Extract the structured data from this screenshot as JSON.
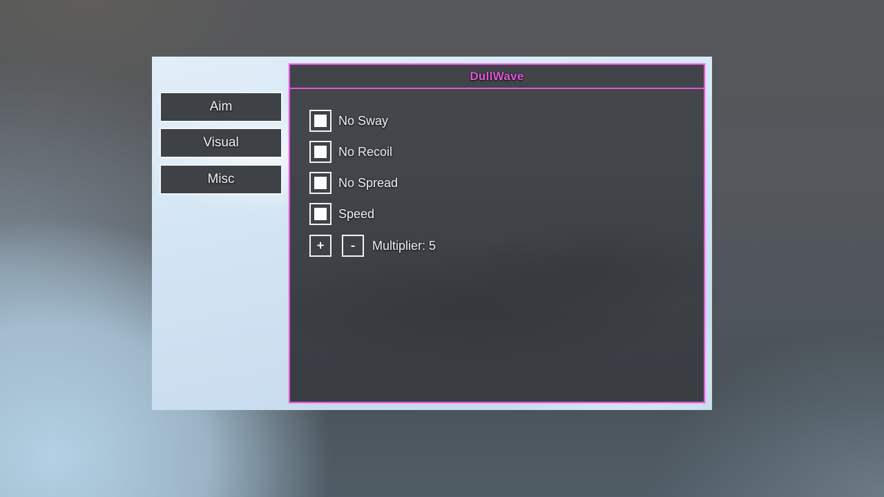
{
  "window": {
    "title": "DullWave",
    "sidebar": {
      "items": [
        {
          "label": "Aim"
        },
        {
          "label": "Visual"
        },
        {
          "label": "Misc"
        }
      ]
    },
    "panel": {
      "checkboxes": [
        {
          "label": "No Sway",
          "checked": false
        },
        {
          "label": "No Recoil",
          "checked": false
        },
        {
          "label": "No Spread",
          "checked": false
        },
        {
          "label": "Speed",
          "checked": false
        }
      ],
      "multiplier": {
        "increase_glyph": "+",
        "decrease_glyph": "-",
        "label_prefix": "Multiplier:",
        "value": "5"
      }
    }
  },
  "colors": {
    "accent_pink": "#e358dd",
    "title_text": "#df59d9",
    "panel_fill": "#404348",
    "control_fill": "#3e4146",
    "control_border": "#f2f4f5",
    "label_text": "#f2f3f4",
    "window_sky": "#d2e4f3"
  }
}
